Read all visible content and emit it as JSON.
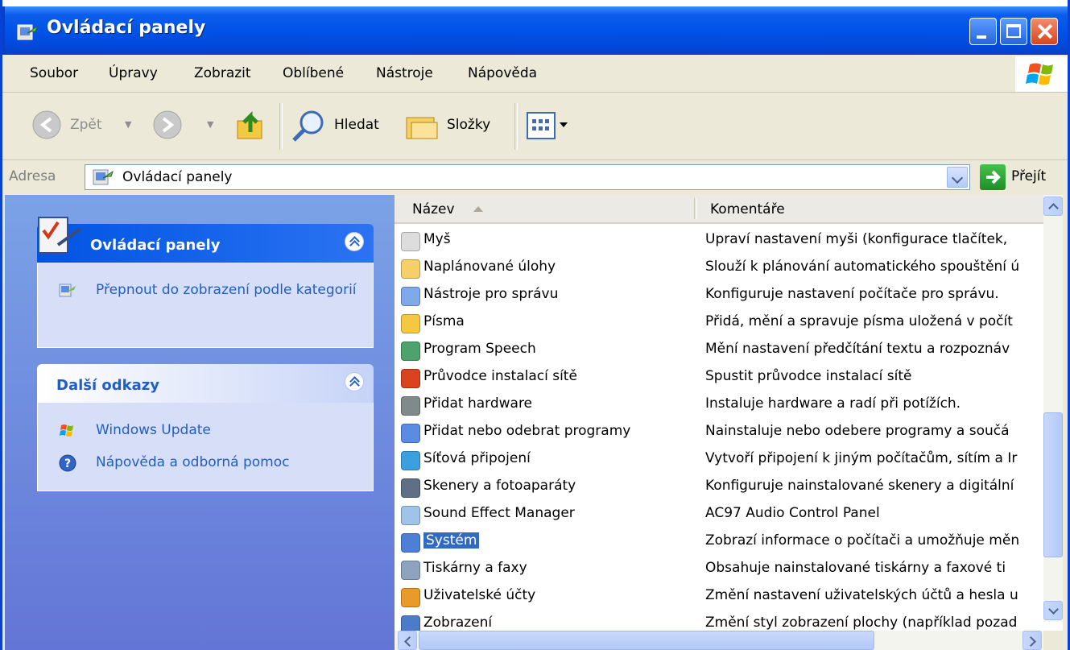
{
  "window": {
    "title": "Ovládací panely"
  },
  "menu": [
    "Soubor",
    "Úpravy",
    "Zobrazit",
    "Oblíbené",
    "Nástroje",
    "Nápověda"
  ],
  "toolbar": {
    "back": "Zpět",
    "search": "Hledat",
    "folders": "Složky"
  },
  "address": {
    "label": "Adresa",
    "value": "Ovládací panely",
    "go": "Přejít"
  },
  "left": {
    "panel1": {
      "title": "Ovládací panely",
      "link": "Přepnout do zobrazení podle kategorií"
    },
    "panel2": {
      "title": "Další odkazy",
      "links": [
        "Windows Update",
        "Nápověda a odborná pomoc"
      ]
    }
  },
  "list": {
    "columns": {
      "name": "Název",
      "comment": "Komentáře"
    },
    "rows": [
      {
        "name": "Myš",
        "comment": "Upraví nastavení myši (konfigurace tlačítek,",
        "icon": "mouse-icon"
      },
      {
        "name": "Naplánované úlohy",
        "comment": "Slouží k plánování automatického spouštění ú",
        "icon": "scheduled-tasks-icon"
      },
      {
        "name": "Nástroje pro správu",
        "comment": "Konfiguruje nastavení počítače pro správu.",
        "icon": "admin-tools-icon"
      },
      {
        "name": "Písma",
        "comment": "Přidá, mění a spravuje písma uložená v počít",
        "icon": "fonts-folder-icon"
      },
      {
        "name": "Program Speech",
        "comment": "Mění nastavení předčítání textu a rozpoznáv",
        "icon": "speech-icon"
      },
      {
        "name": "Průvodce instalací sítě",
        "comment": "Spustit průvodce instalací sítě",
        "icon": "network-wizard-icon"
      },
      {
        "name": "Přidat hardware",
        "comment": "Instaluje hardware a radí při potížích.",
        "icon": "add-hardware-icon"
      },
      {
        "name": "Přidat nebo odebrat programy",
        "comment": "Nainstaluje nebo odebere programy a součá",
        "icon": "add-remove-programs-icon"
      },
      {
        "name": "Síťová připojení",
        "comment": "Vytvoří připojení k jiným počítačům, sítím a Ir",
        "icon": "network-connections-icon"
      },
      {
        "name": "Skenery a fotoaparáty",
        "comment": "Konfiguruje nainstalované skenery a digitální",
        "icon": "scanner-camera-icon"
      },
      {
        "name": "Sound Effect Manager",
        "comment": "AC97 Audio Control Panel",
        "icon": "sound-effect-icon"
      },
      {
        "name": "Systém",
        "comment": "Zobrazí informace o počítači a umožňuje měn",
        "icon": "system-icon",
        "selected": true
      },
      {
        "name": "Tiskárny a faxy",
        "comment": "Obsahuje nainstalované tiskárny a faxové ti",
        "icon": "printers-icon"
      },
      {
        "name": "Uživatelské účty",
        "comment": "Změní nastavení uživatelských účtů a hesla u",
        "icon": "user-accounts-icon"
      },
      {
        "name": "Zobrazení",
        "comment": "Změní styl zobrazení plochy (například pozad",
        "icon": "display-icon"
      }
    ]
  },
  "colors": {
    "titlebar": "#0054E3",
    "selection": "#316AC5",
    "taskpane": "#7BA2E7",
    "link": "#215DC6"
  }
}
